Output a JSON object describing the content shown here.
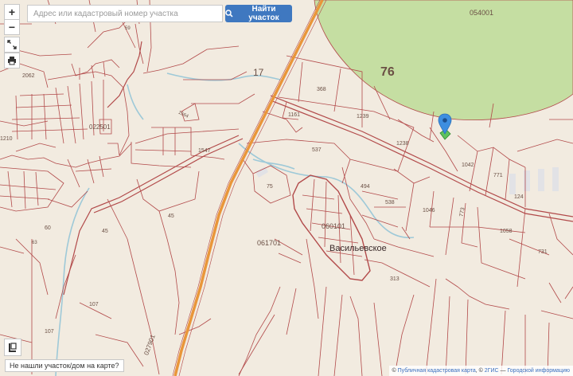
{
  "search": {
    "placeholder": "Адрес или кадастровый номер участка",
    "button_label": "Найти участок"
  },
  "controls": {
    "zoom_in": "+",
    "zoom_out": "−"
  },
  "not_found_label": "Не нашли участок/дом на карте?",
  "attribution": {
    "prefix": "© ",
    "source1": "Публичная кадастровая карта",
    "sep1": ", © ",
    "source2": "2ГИС",
    "sep2": " — ",
    "source3": "Городской информацию"
  },
  "map": {
    "village_name": "Васильевское",
    "labels": {
      "l054001": "054001",
      "l76": "76",
      "l17": "17",
      "l022501": "022501",
      "l060101": "060101",
      "l061701": "061701",
      "l027901": "027901",
      "l368": "368",
      "l1239": "1239",
      "l1238": "1238",
      "l1161": "1161",
      "l537": "537",
      "l494": "494",
      "l538": "538",
      "l1046": "1046",
      "l1042": "1042",
      "l771": "771",
      "l124": "124",
      "l773": "773",
      "l1058": "1058",
      "l731": "731",
      "l1547": "1547",
      "l1564": "1564",
      "l2062": "2062",
      "l1210": "1210",
      "l45a": "45",
      "l45b": "45",
      "l60": "60",
      "l75": "75",
      "l313": "313",
      "l107a": "107",
      "l107b": "107",
      "l59": "59",
      "l63": "63"
    }
  },
  "colors": {
    "background": "#f2ebe0",
    "parcel_lines": "#b24a4a",
    "forest": "#c5dea2",
    "road": "#e9963a",
    "river": "#9ec9d8",
    "marker": "#3d8ee0"
  }
}
